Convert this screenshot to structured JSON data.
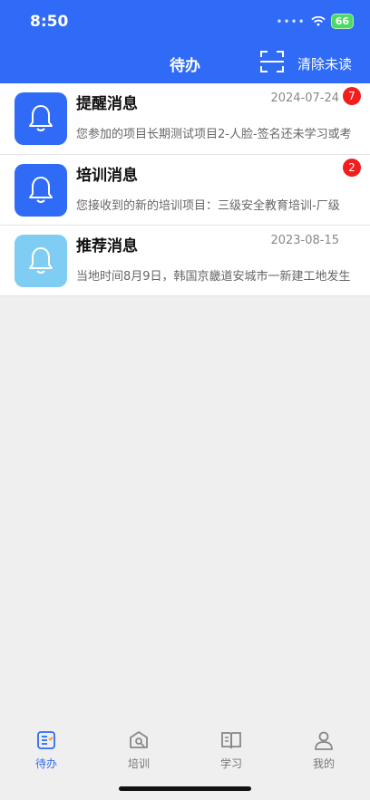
{
  "status_bar": {
    "time": "8:50",
    "battery": "66",
    "battery_color": "#4cd964"
  },
  "nav": {
    "title": "待办",
    "scan_icon": "scan-icon",
    "clear_label": "清除未读"
  },
  "colors": {
    "primary": "#2f6bf6",
    "badge": "#f21d1d",
    "faded_icon": "#7fcdf2"
  },
  "messages": [
    {
      "title": "提醒消息",
      "date": "2024-07-24",
      "badge": "7",
      "preview": "您参加的项目长期测试项目2-人脸-签名还未学习或考",
      "icon": "bell-icon"
    },
    {
      "title": "培训消息",
      "date": "",
      "badge": "2",
      "preview": "您接收到的新的培训项目：三级安全教育培训-厂级",
      "icon": "bell-icon"
    },
    {
      "title": "推荐消息",
      "date": "2023-08-15",
      "badge": "",
      "preview": "当地时间8月9日，韩国京畿道安城市一新建工地发生",
      "icon": "bell-icon"
    }
  ],
  "tabbar": [
    {
      "label": "待办",
      "icon": "todo-icon",
      "active": true
    },
    {
      "label": "培训",
      "icon": "training-icon",
      "active": false
    },
    {
      "label": "学习",
      "icon": "book-icon",
      "active": false
    },
    {
      "label": "我的",
      "icon": "user-icon",
      "active": false
    }
  ]
}
